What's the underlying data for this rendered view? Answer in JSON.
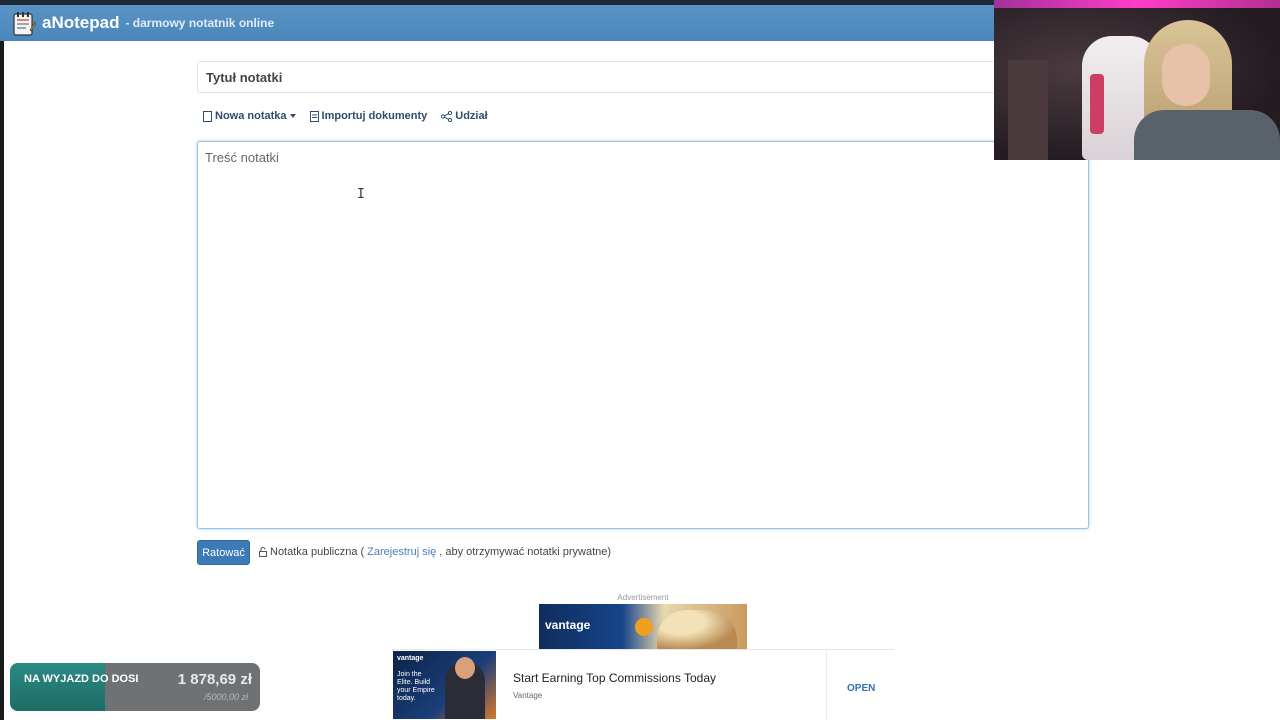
{
  "navbar": {
    "brand_name": "aNotepad",
    "tagline": "- darmowy notatnik online",
    "brand_icon": "notepad-icon"
  },
  "note": {
    "title_placeholder": "Tytuł notatki",
    "content_placeholder": "Treść notatki"
  },
  "toolbar": {
    "new_note_label": "Nowa notatka",
    "import_label": "Importuj dokumenty",
    "share_label": "Udział"
  },
  "save": {
    "button_label": "Ratować",
    "public_prefix": "Notatka publiczna (",
    "register_link": "Zarejestruj się",
    "public_suffix": ", aby otrzymywać notatki prywatne)"
  },
  "advertisement": {
    "label": "Advertisement",
    "banner_brand": "vantage",
    "thumb_brand": "vantage",
    "thumb_text": "Join the Elite. Build your Empire today.",
    "headline": "Start Earning Top Commissions Today",
    "advertiser": "Vantage",
    "cta": "OPEN"
  },
  "donation_overlay": {
    "label": "NA WYJAZD DO DOSI",
    "amount": "1 878,69 zł",
    "goal": "/5000,00 zł",
    "progress": 0.38
  },
  "colors": {
    "navbar": "#4b86ba",
    "save_button": "#3d7ab8",
    "link": "#4a7fb3"
  }
}
